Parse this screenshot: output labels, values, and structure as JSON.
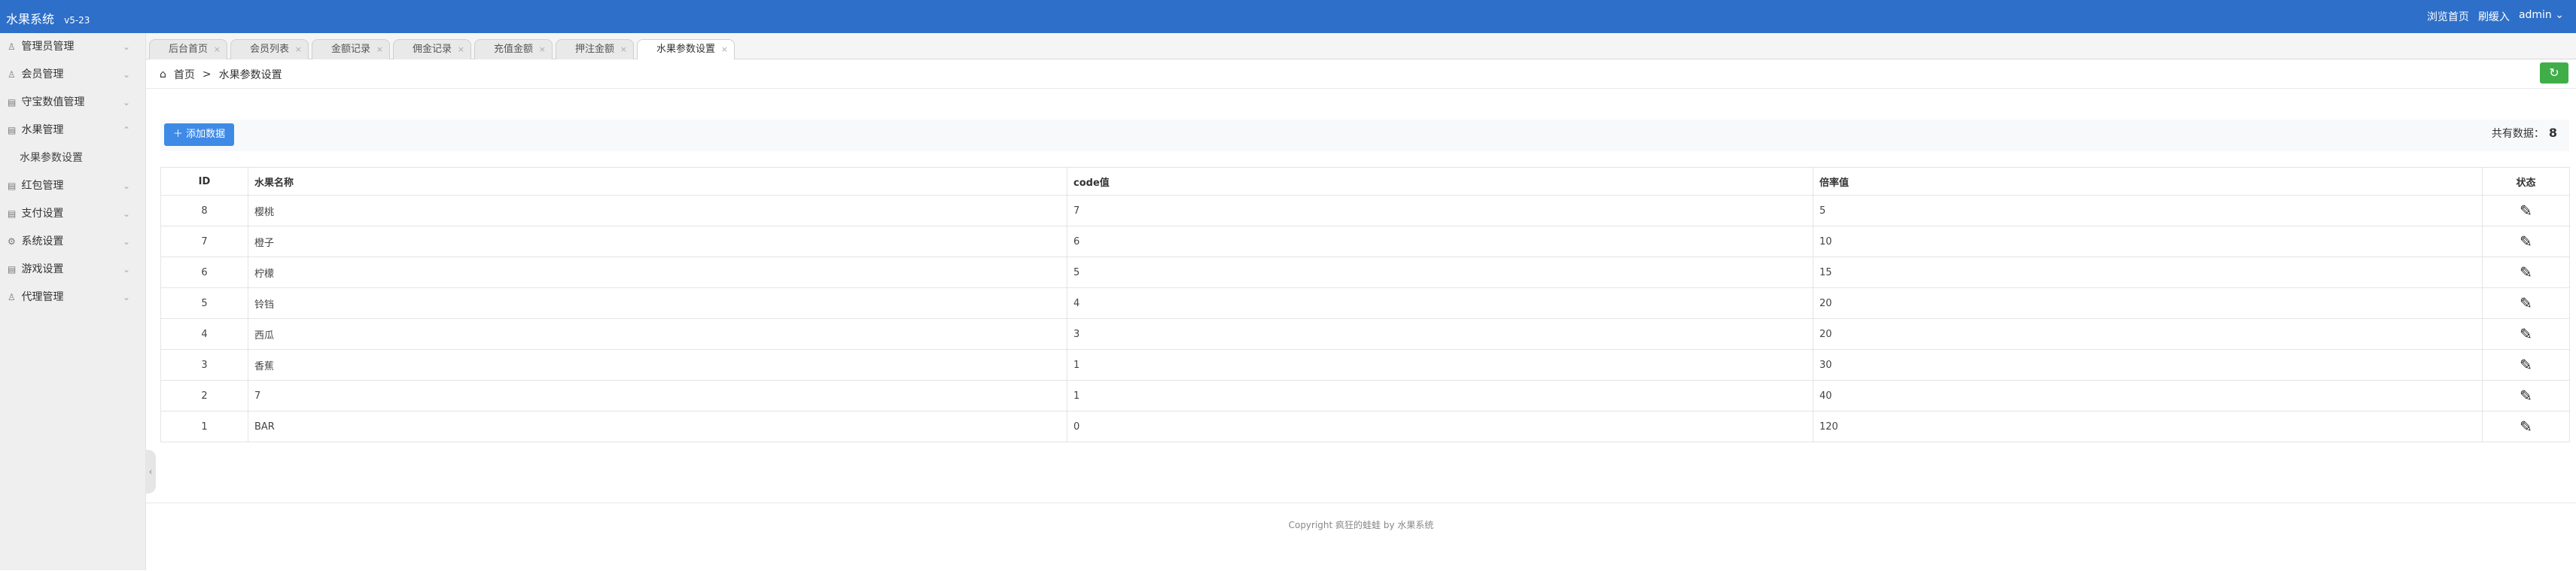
{
  "app": {
    "title": "水果系统",
    "version": "v5-23"
  },
  "topnav": {
    "browse_home": "浏览首页",
    "clear_cache": "刷缓入",
    "user": "admin"
  },
  "sidebar": {
    "items": [
      {
        "label": "管理员管理",
        "icon": "user-icon"
      },
      {
        "label": "会员管理",
        "icon": "user-icon"
      },
      {
        "label": "守宝数值管理",
        "icon": "grid-icon"
      },
      {
        "label": "水果管理",
        "icon": "grid-icon",
        "expanded": true,
        "children": [
          "水果参数设置"
        ]
      },
      {
        "label": "红包管理",
        "icon": "grid-icon"
      },
      {
        "label": "支付设置",
        "icon": "grid-icon"
      },
      {
        "label": "系统设置",
        "icon": "gear-icon"
      },
      {
        "label": "游戏设置",
        "icon": "grid-icon"
      },
      {
        "label": "代理管理",
        "icon": "user-icon"
      }
    ]
  },
  "tabs": [
    {
      "label": "后台首页"
    },
    {
      "label": "会员列表"
    },
    {
      "label": "金额记录"
    },
    {
      "label": "佣金记录"
    },
    {
      "label": "充值金额"
    },
    {
      "label": "押注金额"
    },
    {
      "label": "水果参数设置",
      "active": true
    }
  ],
  "breadcrumb": {
    "home": "首页",
    "separator": ">",
    "current": "水果参数设置"
  },
  "toolbar": {
    "add_label": "添加数据",
    "total_label": "共有数据：",
    "total_value": "8"
  },
  "table": {
    "columns": [
      "ID",
      "水果名称",
      "code值",
      "倍率值",
      "状态"
    ],
    "rows": [
      [
        "8",
        "樱桃",
        "7",
        "5"
      ],
      [
        "7",
        "橙子",
        "6",
        "10"
      ],
      [
        "6",
        "柠檬",
        "5",
        "15"
      ],
      [
        "5",
        "铃铛",
        "4",
        "20"
      ],
      [
        "4",
        "西瓜",
        "3",
        "20"
      ],
      [
        "3",
        "香蕉",
        "1",
        "30"
      ],
      [
        "2",
        "7",
        "1",
        "40"
      ],
      [
        "1",
        "BAR",
        "0",
        "120"
      ]
    ]
  },
  "footer": {
    "text": "Copyright 疯狂的蛙蛙 by 水果系统"
  },
  "colors": {
    "topbar": "#2d6fc9",
    "add_button": "#3e8ae6",
    "refresh_button": "#3fae49"
  }
}
